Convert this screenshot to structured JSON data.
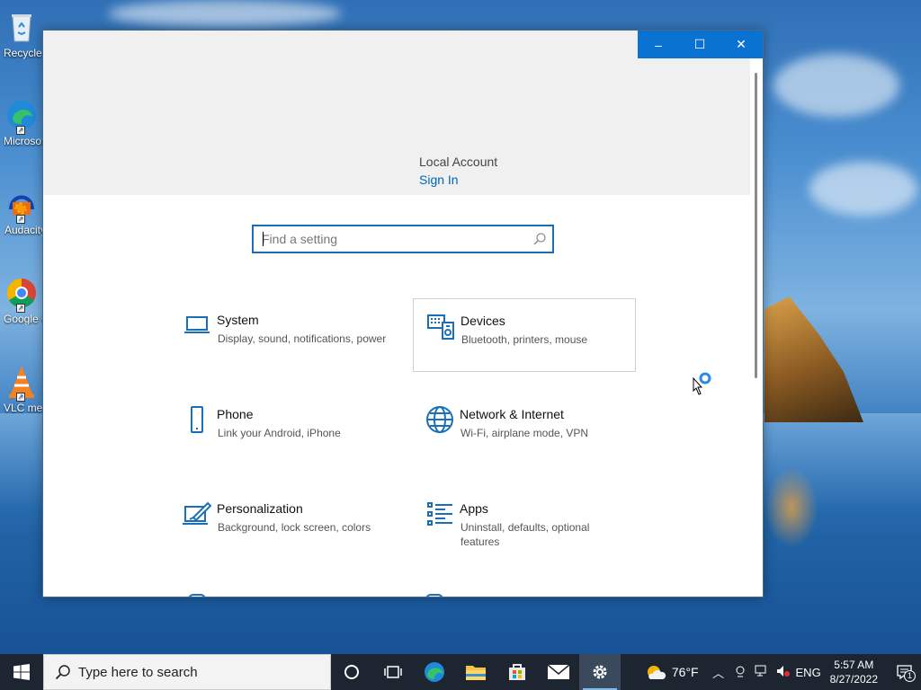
{
  "desktop": {
    "icons": [
      {
        "name": "recycle-bin",
        "label": "Recycle Bin"
      },
      {
        "name": "microsoft-edge",
        "label": "Microsoft Edge"
      },
      {
        "name": "audacity",
        "label": "Audacity"
      },
      {
        "name": "google-chrome",
        "label": "Google Chrome"
      },
      {
        "name": "vlc-media-player",
        "label": "VLC media player"
      }
    ]
  },
  "window": {
    "title": "",
    "controls": {
      "minimize": "–",
      "maximize": "☐",
      "close": "✕"
    },
    "account": {
      "name": "Local Account",
      "action": "Sign In"
    },
    "search": {
      "placeholder": "Find a setting",
      "value": ""
    },
    "categories": [
      {
        "icon": "laptop-icon",
        "title": "System",
        "desc": "Display, sound, notifications, power"
      },
      {
        "icon": "keyboard-devices-icon",
        "title": "Devices",
        "desc": "Bluetooth, printers, mouse"
      },
      {
        "icon": "phone-icon",
        "title": "Phone",
        "desc": "Link your Android, iPhone"
      },
      {
        "icon": "globe-icon",
        "title": "Network & Internet",
        "desc": "Wi-Fi, airplane mode, VPN"
      },
      {
        "icon": "personalization-icon",
        "title": "Personalization",
        "desc": "Background, lock screen, colors"
      },
      {
        "icon": "apps-list-icon",
        "title": "Apps",
        "desc": "Uninstall, defaults, optional features"
      }
    ]
  },
  "taskbar": {
    "search_placeholder": "Type here to search",
    "apps": [
      "cortana",
      "task-view",
      "edge",
      "file-explorer",
      "microsoft-store",
      "mail",
      "settings"
    ],
    "weather": "76°F",
    "language": "ENG",
    "time": "5:57 AM",
    "date": "8/27/2022",
    "notification_count": "1"
  },
  "colors": {
    "accent": "#0a73d1",
    "link": "#0067b8",
    "icon_blue": "#1a6fb8",
    "taskbar": "#1c2530"
  }
}
